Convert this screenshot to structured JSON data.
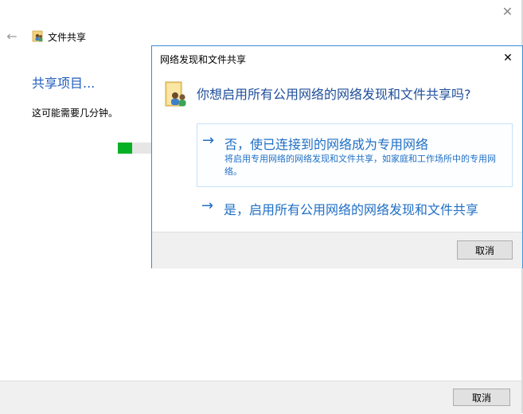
{
  "window": {
    "close_glyph": "✕"
  },
  "nav": {
    "back_glyph": "←",
    "title": "文件共享",
    "icon": "users-folder-icon"
  },
  "main": {
    "heading": "共享项目...",
    "subtext": "这可能需要几分钟。",
    "progress_fraction": 0.4,
    "progress_color": "#06b025"
  },
  "footer": {
    "cancel_label": "取消"
  },
  "dialog": {
    "title": "网络发现和文件共享",
    "close_glyph": "✕",
    "icon": "users-folder-icon",
    "question": "你想启用所有公用网络的网络发现和文件共享吗?",
    "options": [
      {
        "arrow": "→",
        "label": "否，使已连接到的网络成为专用网络",
        "description": "将启用专用网络的网络发现和文件共享，如家庭和工作场所中的专用网络。"
      },
      {
        "arrow": "→",
        "label": "是，启用所有公用网络的网络发现和文件共享"
      }
    ],
    "cancel_label": "取消",
    "accent_color": "#1f6fc5",
    "border_color": "#3b8fd9"
  }
}
